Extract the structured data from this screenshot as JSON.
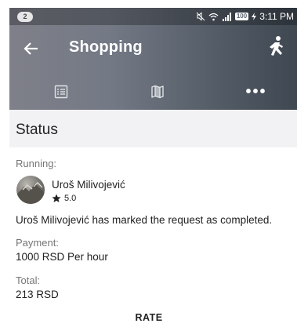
{
  "status_bar": {
    "notification_count": "2",
    "battery": "100",
    "time": "3:11 PM"
  },
  "app_bar": {
    "title": "Shopping",
    "back_icon": "arrow-left-icon",
    "action_icon": "running-person-icon"
  },
  "tabs": [
    {
      "icon": "list-icon"
    },
    {
      "icon": "map-icon"
    },
    {
      "icon": "more-icon",
      "label": "•••"
    }
  ],
  "section": {
    "title": "Status"
  },
  "details": {
    "running_label": "Running:",
    "user_name": "Uroš Milivojević",
    "user_rating": "5.0",
    "status_message": "Uroš Milivojević has marked the request as completed.",
    "payment_label": "Payment:",
    "payment_value": "1000 RSD Per hour",
    "total_label": "Total:",
    "total_value": "213 RSD"
  },
  "actions": {
    "rate_label": "RATE"
  }
}
